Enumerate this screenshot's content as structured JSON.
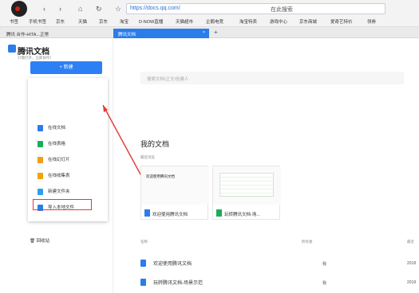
{
  "browser": {
    "url": "https://docs.qq.com/",
    "search_hint": "在此搜索",
    "tabs": [
      {
        "label": "腾讯 合作-HITA...正常"
      },
      {
        "label": "腾讯文档"
      }
    ],
    "bookmarks": [
      "书签",
      "手机书签",
      "京东",
      "天猫",
      "京东",
      "淘宝",
      "D-NOW直播",
      "天猫超市",
      "企鹅电竞",
      "淘宝特卖",
      "游戏中心",
      "京东商城",
      "爱奇艺特价",
      "领券"
    ]
  },
  "sidebar": {
    "brand": "腾讯文档",
    "brand_sub": "只需打开，立即协作！",
    "new_button": "+ 新建",
    "menu": [
      {
        "label": "在线文档",
        "color": "#2b7de9"
      },
      {
        "label": "在线表格",
        "color": "#1aad5a"
      },
      {
        "label": "在线幻灯片",
        "color": "#f59b16"
      },
      {
        "label": "在线收集表",
        "color": "#f0a30a"
      },
      {
        "label": "新建文件夹",
        "color": "#2b9ef0"
      },
      {
        "label": "导入本地文件",
        "color": "#2b7de9"
      }
    ],
    "trash": "回收站"
  },
  "main": {
    "search_placeholder": "搜索文档/正文/创建人",
    "title": "我的文档",
    "recent_label": "最近浏览",
    "cards": [
      {
        "label": "欢迎使用腾讯文档",
        "thumb_title": "欢迎使用腾讯文档"
      },
      {
        "label": "玩转腾讯文档-场..."
      }
    ],
    "columns": {
      "name": "名称",
      "owner": "所有者",
      "date": "最近"
    },
    "rows": [
      {
        "name": "欢迎使用腾讯文档",
        "owner": "我",
        "date": "2018"
      },
      {
        "name": "玩转腾讯文档-场景示范",
        "owner": "我",
        "date": "2018"
      }
    ]
  }
}
